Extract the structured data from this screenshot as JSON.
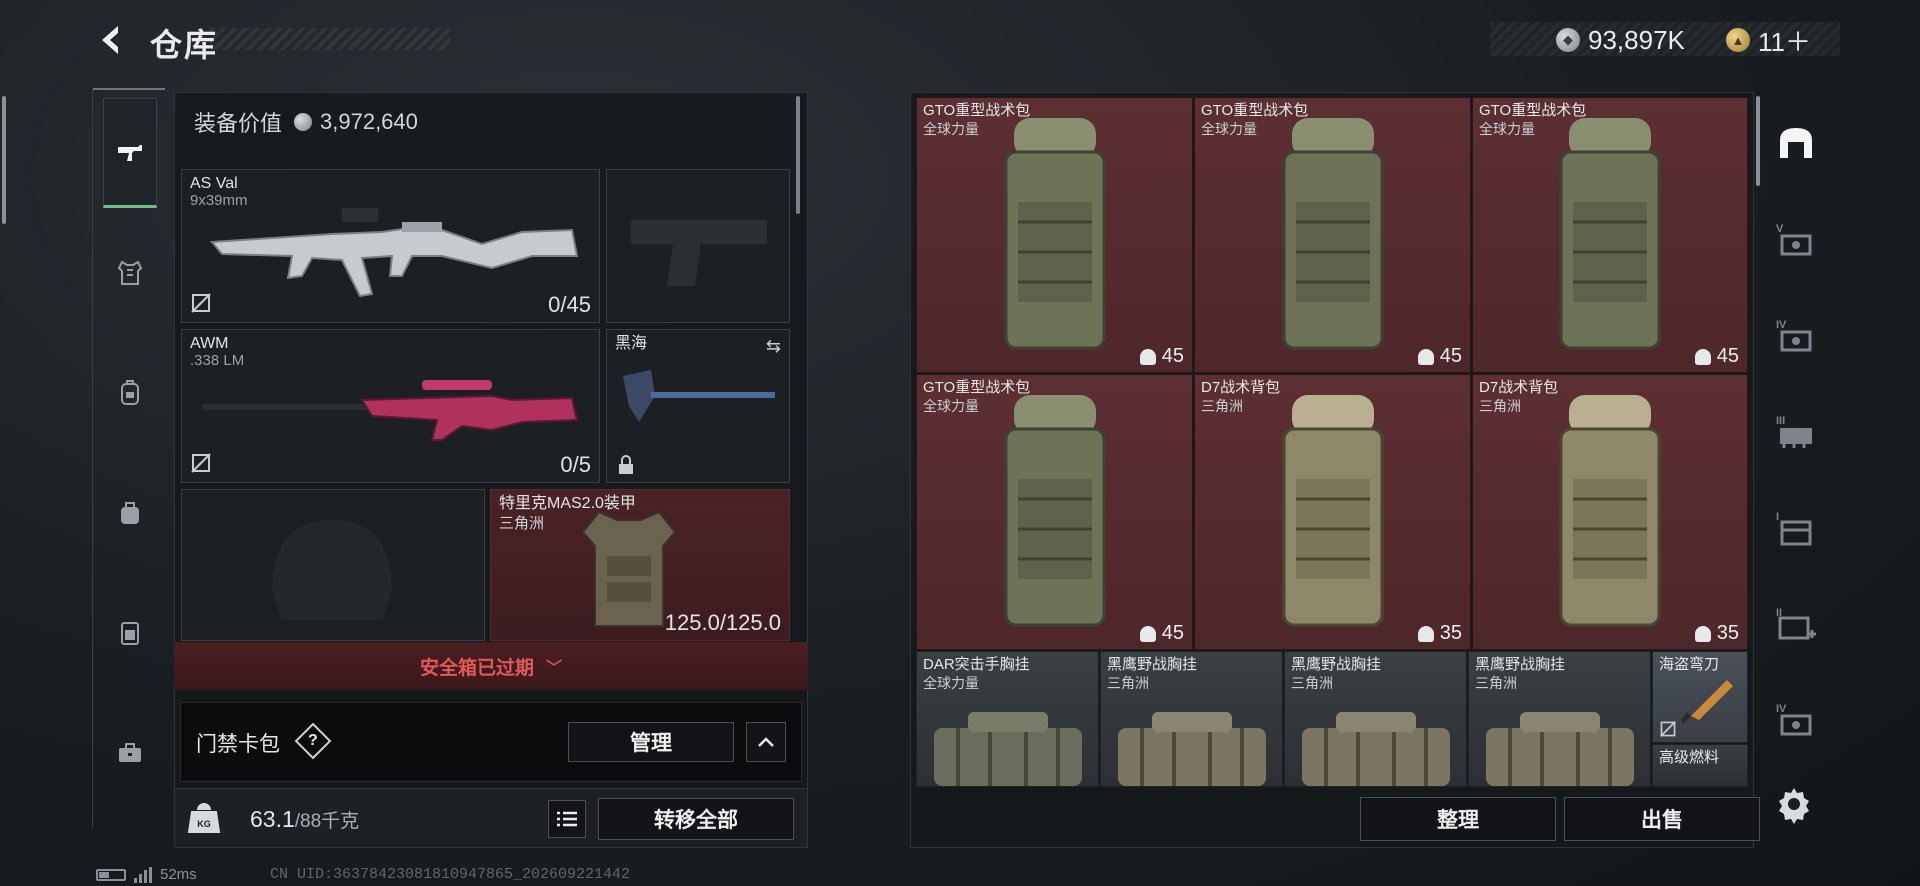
{
  "header": {
    "back_icon": "back-arrow-icon",
    "title": "仓库"
  },
  "currency": {
    "silver": "93,897K",
    "gold": "11＋"
  },
  "left_rail": {
    "items": [
      "weapon-icon",
      "armor-vest-icon",
      "backpack-icon",
      "bag-icon",
      "chest-rig-icon",
      "toolbox-icon"
    ],
    "active": "weapon-icon"
  },
  "equipment": {
    "value_label": "装备价值",
    "value": "3,972,640",
    "primary": {
      "name": "AS Val",
      "ammo": "9x39mm",
      "count": "0/45"
    },
    "pistol": {
      "name": "",
      "ammo": ""
    },
    "secondary": {
      "name": "AWM",
      "ammo": ".338 LM",
      "count": "0/5"
    },
    "melee": {
      "name": "黑海"
    },
    "helmet": {
      "name": ""
    },
    "armor": {
      "name": "特里克MAS2.0装甲",
      "faction": "三角洲",
      "durability": "125.0/125.0"
    },
    "safebox_status": "安全箱已过期",
    "keycard_label": "门禁卡包",
    "help_label": "?",
    "manage_label": "管理",
    "weight_value": "63.1",
    "weight_limit": "/88千克",
    "weight_icon_text": "KG",
    "transfer_all_label": "转移全部"
  },
  "inventory": {
    "items": [
      {
        "name": "GTO重型战术包",
        "faction": "全球力量",
        "durability": "45"
      },
      {
        "name": "GTO重型战术包",
        "faction": "全球力量",
        "durability": "45"
      },
      {
        "name": "GTO重型战术包",
        "faction": "全球力量",
        "durability": "45"
      },
      {
        "name": "GTO重型战术包",
        "faction": "全球力量",
        "durability": "45"
      },
      {
        "name": "D7战术背包",
        "faction": "三角洲",
        "durability": "35"
      },
      {
        "name": "D7战术背包",
        "faction": "三角洲",
        "durability": "35"
      },
      {
        "name": "DAR突击手胸挂",
        "faction": "全球力量"
      },
      {
        "name": "黑鹰野战胸挂",
        "faction": "三角洲"
      },
      {
        "name": "黑鹰野战胸挂",
        "faction": "三角洲"
      },
      {
        "name": "黑鹰野战胸挂",
        "faction": "三角洲"
      },
      {
        "name": "海盗弯刀",
        "faction": ""
      },
      {
        "name": "高级燃料",
        "faction": ""
      }
    ],
    "sort_label": "整理",
    "sell_label": "出售"
  },
  "right_rail": {
    "items": [
      {
        "icon": "all-items-icon",
        "tier": ""
      },
      {
        "icon": "tier5-item-icon",
        "tier": "V"
      },
      {
        "icon": "tier4-item-icon",
        "tier": "IV"
      },
      {
        "icon": "tier3-item-icon",
        "tier": "III"
      },
      {
        "icon": "tier1-item-icon",
        "tier": "I"
      },
      {
        "icon": "tier2-medical-icon",
        "tier": "II"
      },
      {
        "icon": "tier4-key-icon",
        "tier": "IV"
      }
    ]
  },
  "footer": {
    "ping": "52ms",
    "uid": "CN UID:3637842308181094786​5_202609221442"
  }
}
